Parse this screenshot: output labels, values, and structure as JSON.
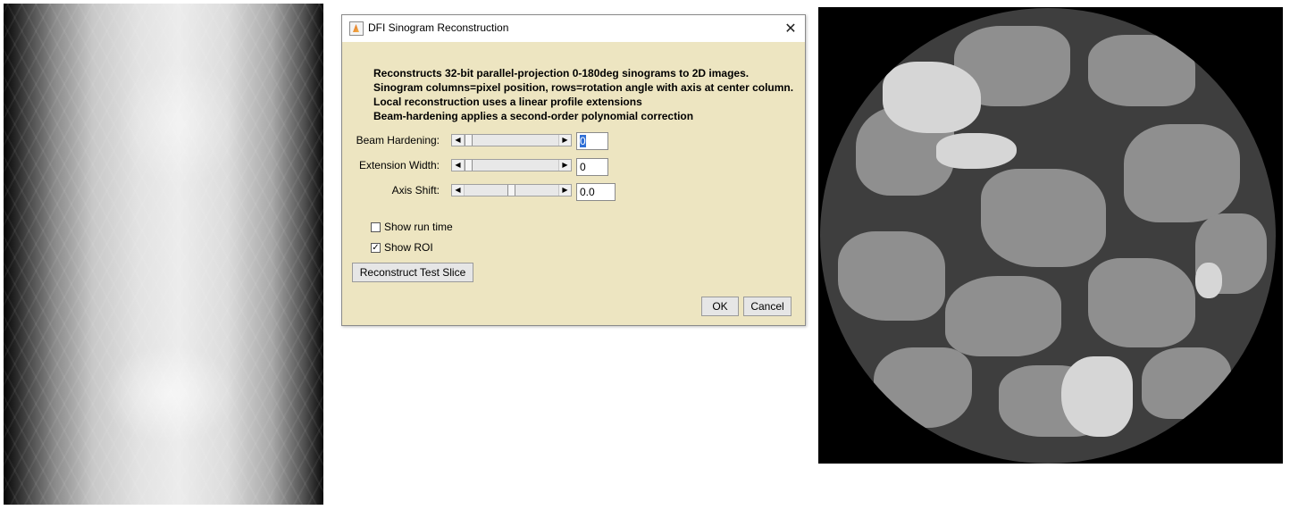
{
  "dialog": {
    "title": "DFI Sinogram Reconstruction",
    "description": [
      "Reconstructs 32-bit parallel-projection 0-180deg sinograms to 2D images.",
      "Sinogram columns=pixel position, rows=rotation angle with axis at center column.",
      "Local reconstruction uses a linear profile extensions",
      "Beam-hardening applies a second-order polynomial correction"
    ],
    "params": {
      "beam_hardening": {
        "label": "Beam Hardening:",
        "value": "0"
      },
      "extension_width": {
        "label": "Extension Width:",
        "value": "0"
      },
      "axis_shift": {
        "label": "Axis Shift:",
        "value": "0.0"
      }
    },
    "checkboxes": {
      "show_run_time": {
        "label": "Show run time",
        "checked": false
      },
      "show_roi": {
        "label": "Show ROI",
        "checked": true
      }
    },
    "buttons": {
      "reconstruct": "Reconstruct Test Slice",
      "ok": "OK",
      "cancel": "Cancel"
    }
  },
  "icons": {
    "app": "java-coffee-icon",
    "close": "close-icon",
    "left_arrow": "left-arrow-icon",
    "right_arrow": "right-arrow-icon",
    "check": "checkmark-icon"
  },
  "colors": {
    "dialog_bg": "#ede5c1",
    "selection": "#2f6fd6"
  }
}
